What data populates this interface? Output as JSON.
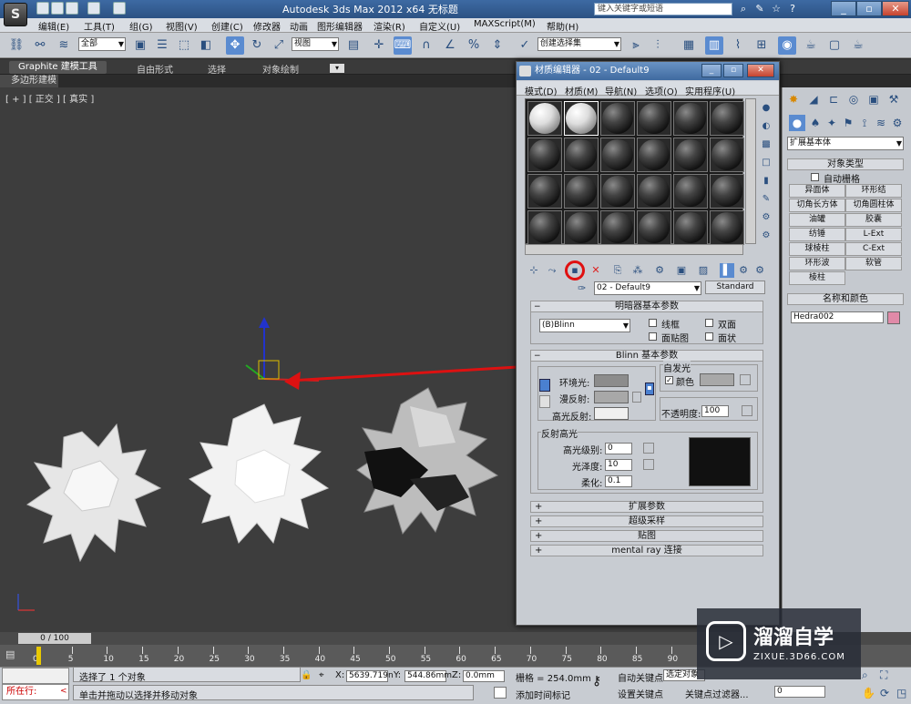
{
  "titlebar": {
    "app_title": "Autodesk 3ds Max  2012 x64     无标题",
    "search_placeholder": "键入关键字或短语"
  },
  "menubar": [
    "编辑(E)",
    "工具(T)",
    "组(G)",
    "视图(V)",
    "创建(C)",
    "修改器",
    "动画",
    "图形编辑器",
    "渲染(R)",
    "自定义(U)",
    "MAXScript(M)",
    "帮助(H)"
  ],
  "toolbar": {
    "selection_filter": "全部",
    "ref_coord": "视图",
    "named_selection": "创建选择集"
  },
  "ribbon": {
    "tabs": [
      "Graphite 建模工具",
      "自由形式",
      "选择",
      "对象绘制"
    ],
    "sub": "多边形建模"
  },
  "viewport": {
    "label": "[ + ] [ 正交 ] [ 真实 ]"
  },
  "material_editor": {
    "title": "材质编辑器 - 02 - Default9",
    "menu": [
      "模式(D)",
      "材质(M)",
      "导航(N)",
      "选项(O)",
      "实用程序(U)"
    ],
    "material_name": "02 - Default9",
    "material_type": "Standard",
    "shader_rollout": {
      "title": "明暗器基本参数",
      "shader": "(B)Blinn",
      "options": [
        "线框",
        "双面",
        "面贴图",
        "面状"
      ]
    },
    "blinn_rollout": {
      "title": "Blinn 基本参数",
      "ambient": "环境光:",
      "diffuse": "漫反射:",
      "specular": "高光反射:",
      "self_illum_group": "自发光",
      "color_label": "颜色",
      "opacity_label": "不透明度:",
      "opacity_value": "100",
      "spec_group": "反射高光",
      "spec_level_label": "高光级别:",
      "spec_level": "0",
      "gloss_label": "光泽度:",
      "gloss": "10",
      "soften_label": "柔化:",
      "soften": "0.1"
    },
    "collapsed_rollouts": [
      "扩展参数",
      "超级采样",
      "贴图",
      "mental ray 连接"
    ]
  },
  "command_panel": {
    "category": "扩展基本体",
    "object_type_title": "对象类型",
    "autogrid": "自动栅格",
    "buttons": [
      "异面体",
      "环形结",
      "切角长方体",
      "切角圆柱体",
      "油罐",
      "胶囊",
      "纺锤",
      "L-Ext",
      "球棱柱",
      "C-Ext",
      "环形波",
      "软管",
      "棱柱"
    ],
    "name_color_title": "名称和颜色",
    "object_name": "Hedra002",
    "object_color": "#e08aa8"
  },
  "timeline": {
    "frame": "0 / 100",
    "ticks": [
      "0",
      "5",
      "10",
      "15",
      "20",
      "25",
      "30",
      "35",
      "40",
      "45",
      "50",
      "55",
      "60",
      "65",
      "70",
      "75",
      "80",
      "85",
      "90"
    ]
  },
  "status": {
    "maxscript_line2": "所在行: ",
    "selected": "选择了 1 个对象",
    "hint": "单击并拖动以选择并移动对象",
    "x_label": "X:",
    "x_value": "5639.719n",
    "y_label": "Y:",
    "y_value": "544.86mm",
    "z_label": "Z:",
    "z_value": "0.0mm",
    "grid": "栅格 = 254.0mm",
    "add_time_tag": "添加时间标记",
    "auto_key": "自动关键点",
    "set_key": "设置关键点",
    "selected_dropdown": "选定对象",
    "key_filters": "关键点过滤器...",
    "frame_spinner": "0"
  },
  "watermark": {
    "brand": "溜溜自学",
    "url": "ZIXUE.3D66.COM"
  }
}
